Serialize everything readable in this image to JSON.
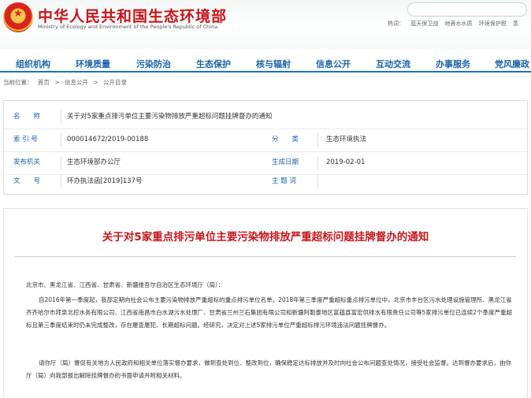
{
  "site": {
    "title_cn": "中华人民共和国生态环境部",
    "title_en": "Ministry of Ecology and Environment of the People's Republic of China",
    "hot_links": [
      "热词：",
      "蓝天保卫战",
      "地表水水质",
      "环境保护税",
      "蒸"
    ]
  },
  "nav": [
    {
      "label": "组织机构"
    },
    {
      "label": "环境质量"
    },
    {
      "label": "污染防治"
    },
    {
      "label": "生态保护"
    },
    {
      "label": "核与辐射"
    },
    {
      "label": "信息公开"
    },
    {
      "label": "互动交流"
    },
    {
      "label": "办事服务"
    },
    {
      "label": "党风廉政"
    }
  ],
  "breadcrumb": {
    "prefix": "当前位置：",
    "items": [
      "首页",
      ">",
      "信息公开",
      ">",
      "公开目录"
    ]
  },
  "info": {
    "name_label": "名　　称",
    "name_value": "关于对5家重点排污单位主要污染物排放严重超标问题挂牌督办的通知",
    "index_label": "索 引 号",
    "index_value": "000014672/2019-00188",
    "category_label": "分　　类",
    "category_value": "生态环境执法",
    "issuer_label": "发布机关",
    "issuer_value": "生态环境部办公厅",
    "date_label": "生成日期",
    "date_value": "2019-02-01",
    "docno_label": "文　　号",
    "docno_value": "环办执法函[2019]137号",
    "subject_label": "主 题 词",
    "subject_value": ""
  },
  "article": {
    "title": "关于对5家重点排污单位主要污染物排放严重超标问题挂牌督办的通知",
    "addressee": "北京市、黑龙江省、江西省、甘肃省、新疆维吾尔自治区生态环境厅（局）：",
    "para1": "自2016年第一季度起，我部定期向社会公布主要污染物排放严重超标的重点排污单位名单。2018年第三季度严重超标重点排污单位中，北京市丰台区污水处理设施管理所、黑龙江省齐齐哈尔市拜泉北控水务有限公司、江西省南昌市白水湖污水处理厂、甘肃省兰州兰石集团有限公司和新疆阿勒泰地区富蕴县富宏供排水有限责任公司等5家排污单位已连续2个季度严重超标且第三季度结束时仍未完成整改，存在屡查屡犯、长期超标问题。经研究，决定对上述5家排污单位严重超标排污环境违法问题挂牌督办。",
    "para2": "请你厅（局）督促有关地方人民政府和相关单位落实督办要求，做到查处到位、整改到位，确保稳定达标排放并及时向社会公布问题查处情况，接受社会监督。达到督办要求后，由你厅（局）向我部报出解除挂牌督办的书面申请并附相关材料。"
  }
}
